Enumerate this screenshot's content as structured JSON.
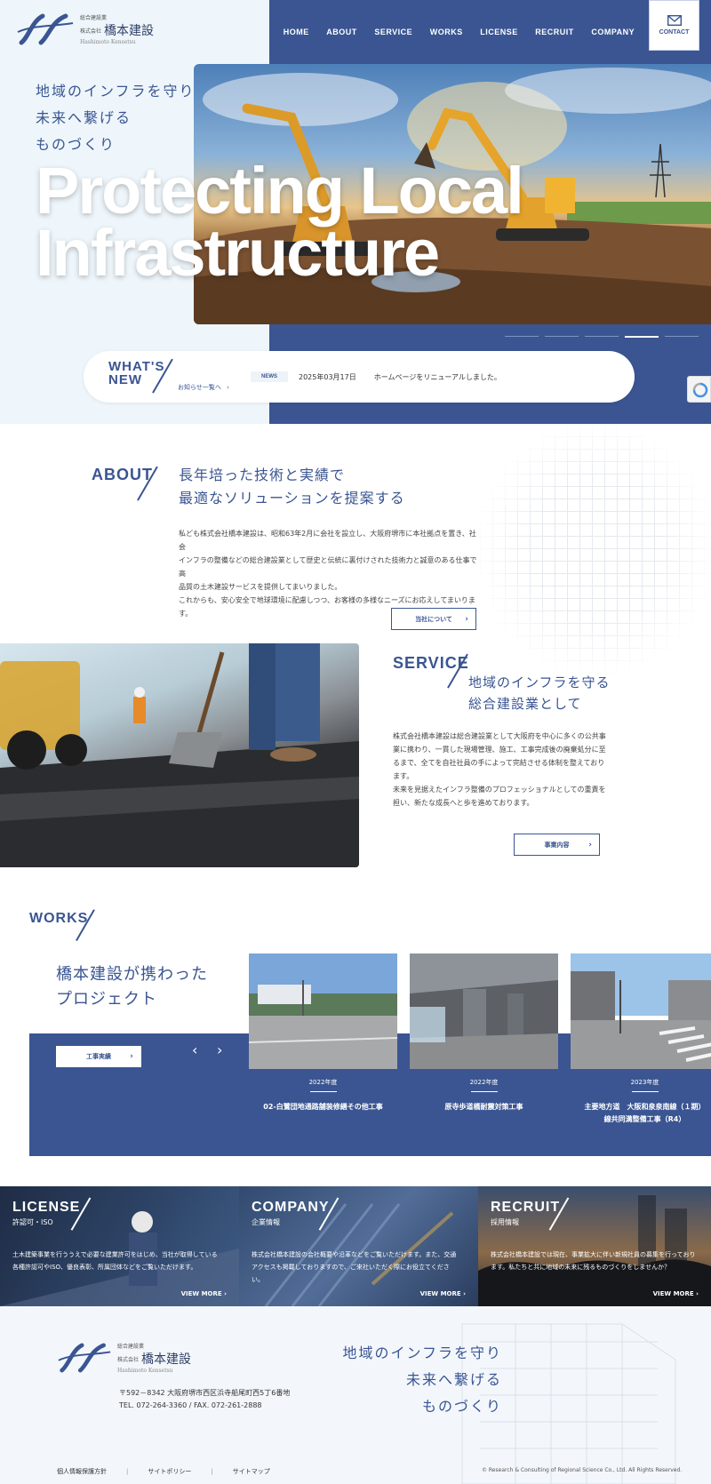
{
  "header": {
    "logo_small": "総合建設業",
    "logo_corp": "株式会社",
    "logo_name": "橋本建設",
    "logo_en": "Hashimoto Kensetsu",
    "nav": [
      "HOME",
      "ABOUT",
      "SERVICE",
      "WORKS",
      "LICENSE",
      "RECRUIT",
      "COMPANY"
    ],
    "contact_label": "CONTACT",
    "contact_icon": "mail-icon"
  },
  "hero": {
    "copy_lines": [
      "地域のインフラを守り",
      "未来へ繋げる",
      "ものづくり"
    ],
    "big_lines": [
      "Protecting Local",
      "Infrastructure"
    ],
    "slides_total": 5,
    "slide_active": 4
  },
  "news": {
    "heading_1": "WHAT'S",
    "heading_2": "NEW",
    "list_link": "お知らせ一覧へ",
    "tag": "NEWS",
    "date": "2025年03月17日",
    "text": "ホームページをリニューアルしました。"
  },
  "about": {
    "heading": "ABOUT",
    "title_1": "長年培った技術と実績で",
    "title_2": "最適なソリューションを提案する",
    "body_1": "私ども株式会社橋本建設は、昭和63年2月に会社を設立し、大阪府堺市に本社拠点を置き、社会",
    "body_2": "インフラの整備などの総合建設業として歴史と伝統に裏付けされた技術力と誠意のある仕事で高",
    "body_3": "品質の土木建設サービスを提供してまいりました。",
    "body_4": "これからも、安心安全で地球環境に配慮しつつ、お客様の多様なニーズにお応えしてまいりま",
    "body_5": "す。",
    "button": "当社について"
  },
  "service": {
    "heading": "SERVICE",
    "title_1": "地域のインフラを守る",
    "title_2": "総合建設業として",
    "body_1": "株式会社橋本建設は総合建設業として大阪府を中心に多くの公共事",
    "body_2": "業に携わり、一貫した現場管理、施工、工事完成後の廃棄処分に至",
    "body_3": "るまで、全てを自社社員の手によって完結させる体制を整えており",
    "body_4": "ます。",
    "body_5": "未来を見据えたインフラ整備のプロフェッショナルとしての重責を",
    "body_6": "担い、新たな成長へと歩を進めております。",
    "button": "事業内容"
  },
  "works": {
    "heading": "WORKS",
    "title_1": "橋本建設が携わった",
    "title_2": "プロジェクト",
    "button": "工事実績",
    "items": [
      {
        "year": "2022年度",
        "title_1": "02-白鷺団地通路舗装修繕その他工事",
        "title_2": ""
      },
      {
        "year": "2022年度",
        "title_1": "原寺歩道橋耐震対策工事",
        "title_2": ""
      },
      {
        "year": "2023年度",
        "title_1": "主要地方道　大阪和泉泉南線（１期）",
        "title_2": "線共同溝整備工事（R4）"
      }
    ]
  },
  "panels": [
    {
      "heading": "LICENSE",
      "sub": "許認可・ISO",
      "desc_1": "土木建築事業を行ううえで必要な建業許可をはじめ、当社が取得している",
      "desc_2": "各種許認可やISO、優良表彰、所属団体などをご覧いただけます。",
      "more": "VIEW MORE"
    },
    {
      "heading": "COMPANY",
      "sub": "企業情報",
      "desc_1": "株式会社橋本建設の会社概要や沿革などをご覧いただけます。また、交通",
      "desc_2": "アクセスも掲載しておりますので、ご来社いただく際にお役立てくださ",
      "desc_3": "い。",
      "more": "VIEW MORE"
    },
    {
      "heading": "RECRUIT",
      "sub": "採用情報",
      "desc_1": "株式会社橋本建設では現在、事業拡大に伴い新規社員の募集を行っており",
      "desc_2": "ます。私たちと共に地域の未来に残るものづくりをしませんか？",
      "more": "VIEW MORE"
    }
  ],
  "footer": {
    "address": "〒592－8342 大阪府堺市西区浜寺船尾町西5丁6番地",
    "tel": "TEL. 072-264-3360 / FAX. 072-261-2888",
    "copy_lines": [
      "地域のインフラを守り",
      "未来へ繋げる",
      "ものづくり"
    ],
    "links": [
      "個人情報保護方針",
      "サイトポリシー",
      "サイトマップ"
    ],
    "copyright": "© Research & Consulting of Regional Science Co., Ltd. All Rights Reserved."
  }
}
